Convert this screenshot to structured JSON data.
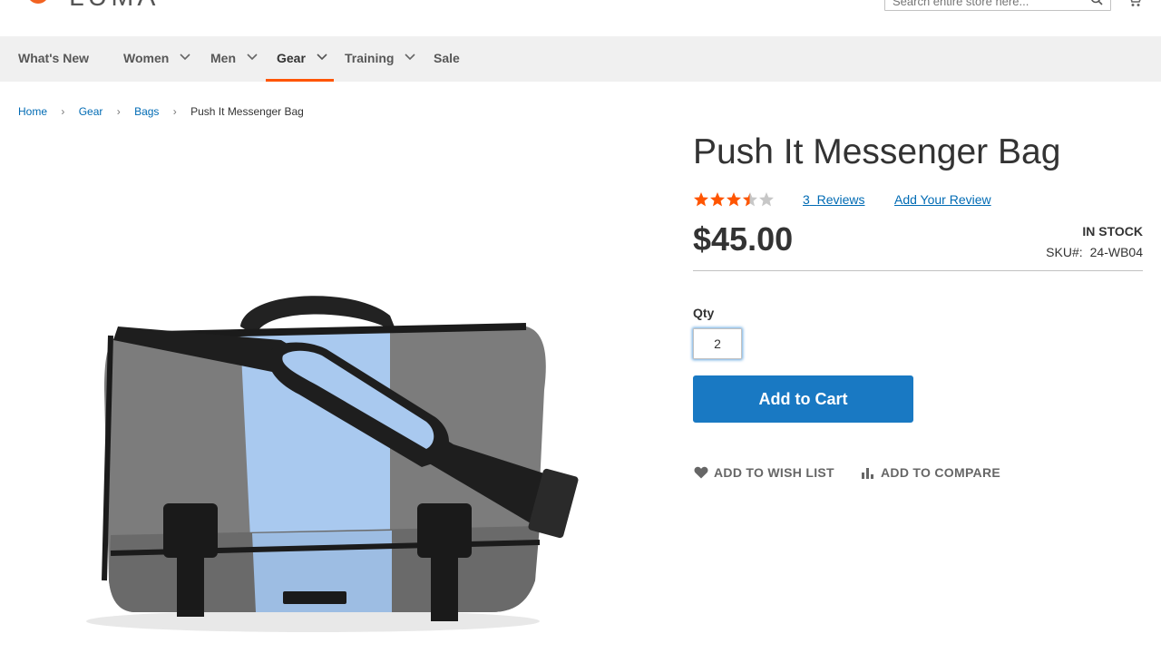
{
  "header": {
    "logo_text": "LUMA",
    "search_placeholder": "Search entire store here...",
    "icons": [
      "logo-icon",
      "search-icon",
      "cart-icon"
    ]
  },
  "nav": {
    "items": [
      {
        "label": "What's New",
        "has_submenu": false
      },
      {
        "label": "Women",
        "has_submenu": true
      },
      {
        "label": "Men",
        "has_submenu": true
      },
      {
        "label": "Gear",
        "has_submenu": true,
        "active": true
      },
      {
        "label": "Training",
        "has_submenu": true
      },
      {
        "label": "Sale",
        "has_submenu": false
      }
    ]
  },
  "breadcrumbs": {
    "items": [
      "Home",
      "Gear",
      "Bags"
    ],
    "current": "Push It Messenger Bag"
  },
  "product": {
    "name": "Push It Messenger Bag",
    "rating_stars": 3.5,
    "rating_max": 5,
    "reviews_count": "3",
    "reviews_label": "Reviews",
    "add_review_label": "Add Your Review",
    "price": "$45.00",
    "stock_status": "IN STOCK",
    "sku_label": "SKU#:",
    "sku": "24-WB04",
    "qty_label": "Qty",
    "qty_value": "2",
    "add_to_cart_label": "Add to Cart",
    "wishlist_label": "ADD TO WISH LIST",
    "compare_label": "ADD TO COMPARE"
  },
  "colors": {
    "accent": "#ff5501",
    "link": "#006bb4",
    "primary_button": "#1979c3",
    "nav_bg": "#f0f0f0",
    "star": "#ff5501"
  }
}
